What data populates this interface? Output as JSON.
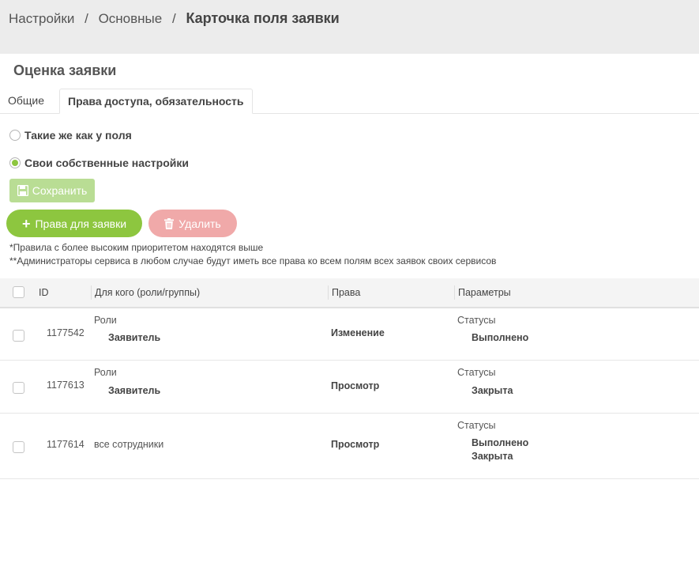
{
  "breadcrumb": {
    "items": [
      "Настройки",
      "Основные"
    ],
    "separator": "/",
    "current": "Карточка поля заявки"
  },
  "section_title": "Оценка заявки",
  "tabs": [
    {
      "label": "Общие",
      "active": false
    },
    {
      "label": "Права доступа, обязательность",
      "active": true
    }
  ],
  "access_mode": {
    "options": [
      {
        "label": "Такие же как у поля",
        "checked": false
      },
      {
        "label": "Свои собственные настройки",
        "checked": true
      }
    ]
  },
  "buttons": {
    "save_label": "Сохранить",
    "add_label": "Права для заявки",
    "delete_label": "Удалить"
  },
  "notes": [
    "*Правила с более высоким приоритетом находятся выше",
    "**Администраторы сервиса в любом случае будут иметь все права ко всем полям всех заявок своих сервисов"
  ],
  "table": {
    "headers": {
      "id": "ID",
      "who": "Для кого (роли/группы)",
      "rights": "Права",
      "params": "Параметры"
    },
    "rows": [
      {
        "id": "1177542",
        "who_type": "Роли",
        "who_items": [
          "Заявитель"
        ],
        "rights": "Изменение",
        "params_type": "Статусы",
        "params_items": [
          "Выполнено"
        ]
      },
      {
        "id": "1177613",
        "who_type": "Роли",
        "who_items": [
          "Заявитель"
        ],
        "rights": "Просмотр",
        "params_type": "Статусы",
        "params_items": [
          "Закрыта"
        ]
      },
      {
        "id": "1177614",
        "who_plain": "все сотрудники",
        "rights": "Просмотр",
        "params_type": "Статусы",
        "params_items": [
          "Выполнено",
          "Закрыта"
        ]
      }
    ]
  },
  "colors": {
    "accent_green": "#8dc63f",
    "save_disabled": "#b9dd94",
    "delete_disabled": "#f0a9a9",
    "header_bg": "#ececec"
  }
}
